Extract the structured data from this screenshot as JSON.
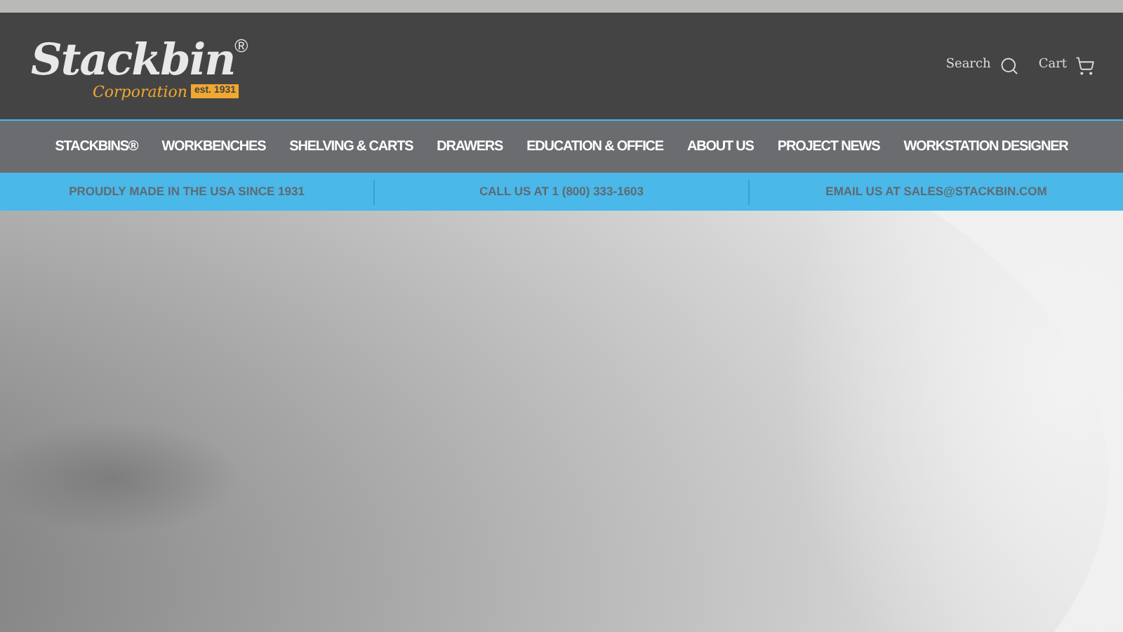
{
  "logo": {
    "name": "Stackbin",
    "mark": "®",
    "subtitle": "Corporation",
    "established": "est. 1931"
  },
  "header_links": [
    {
      "kind": "search",
      "label": "Search"
    },
    {
      "kind": "cart",
      "label": "Cart"
    }
  ],
  "nav": [
    "STACKBINS®",
    "WORKBENCHES",
    "SHELVING & CARTS",
    "DRAWERS",
    "EDUCATION & OFFICE",
    "ABOUT US",
    "PROJECT NEWS",
    "WORKSTATION DESIGNER"
  ],
  "announcements": [
    "PROUDLY MADE IN THE USA SINCE 1931",
    "CALL US AT 1 (800) 333-1603",
    "EMAIL US AT SALES@STACKBIN.COM"
  ]
}
